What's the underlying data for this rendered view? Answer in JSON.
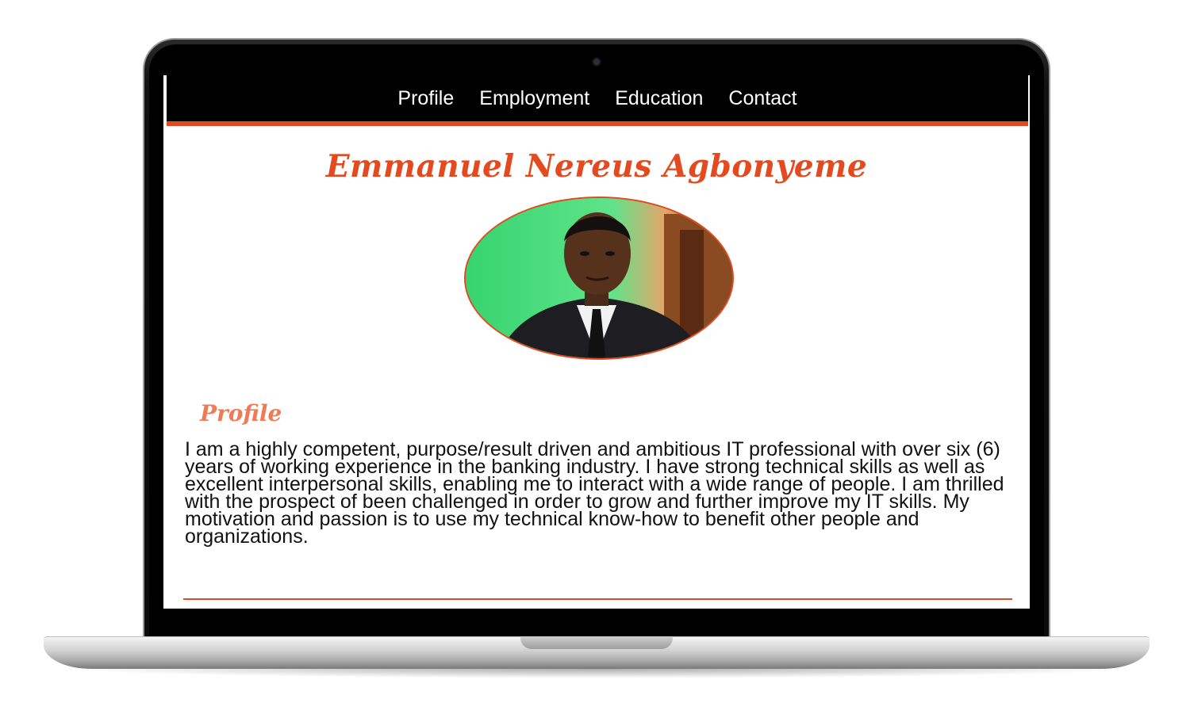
{
  "nav": {
    "items": [
      "Profile",
      "Employment",
      "Education",
      "Contact"
    ]
  },
  "header": {
    "name": "Emmanuel Nereus Agbonyeme"
  },
  "profile": {
    "heading": "Profile",
    "text": "I am a highly competent, purpose/result driven and ambitious IT professional with over six (6) years of working experience in the banking industry. I have strong technical skills as well as excellent interpersonal skills, enabling me to interact with a wide range of people. I am thrilled with the prospect of been challenged in order to grow and further improve my IT skills. My motivation and passion is to use my technical know-how to benefit other people and organizations."
  },
  "colors": {
    "accent": "#e34a1f",
    "heading": "#f07a56",
    "navbar": "#000000"
  }
}
